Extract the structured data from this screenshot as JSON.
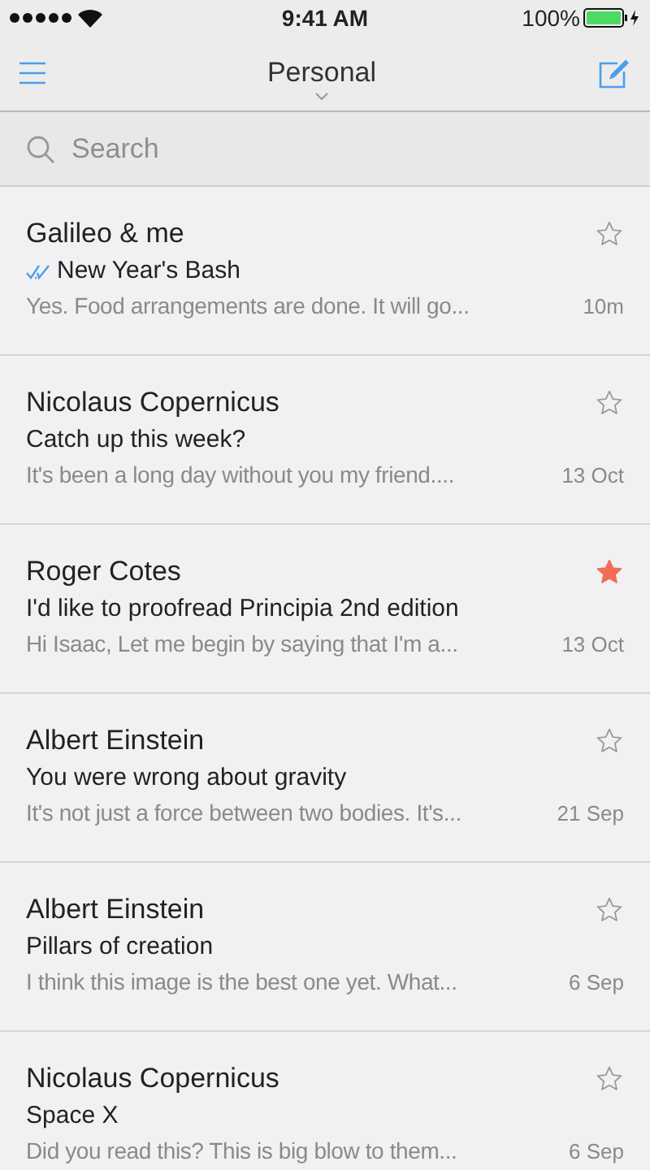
{
  "status_bar": {
    "time": "9:41 AM",
    "battery": "100%"
  },
  "nav": {
    "title": "Personal"
  },
  "search": {
    "placeholder": "Search"
  },
  "messages": [
    {
      "sender": "Galileo & me",
      "subject": "New Year's Bash",
      "preview": "Yes. Food arrangements are done. It will go...",
      "date": "10m",
      "replied": true,
      "starred": false
    },
    {
      "sender": "Nicolaus Copernicus",
      "subject": "Catch up this week?",
      "preview": "It's been a long day without you my friend....",
      "date": "13 Oct",
      "replied": false,
      "starred": false
    },
    {
      "sender": "Roger Cotes",
      "subject": "I'd like to proofread Principia 2nd edition",
      "preview": "Hi Isaac, Let me begin by saying that I'm a...",
      "date": "13 Oct",
      "replied": false,
      "starred": true
    },
    {
      "sender": "Albert Einstein",
      "subject": "You were wrong about gravity",
      "preview": "It's not just a force between two bodies. It's...",
      "date": "21 Sep",
      "replied": false,
      "starred": false
    },
    {
      "sender": "Albert Einstein",
      "subject": "Pillars of creation",
      "preview": "I think this image is the best one yet. What...",
      "date": "6 Sep",
      "replied": false,
      "starred": false
    },
    {
      "sender": "Nicolaus Copernicus",
      "subject": "Space X",
      "preview": "Did you read this? This is big blow to them...",
      "date": "6 Sep",
      "replied": false,
      "starred": false
    }
  ]
}
